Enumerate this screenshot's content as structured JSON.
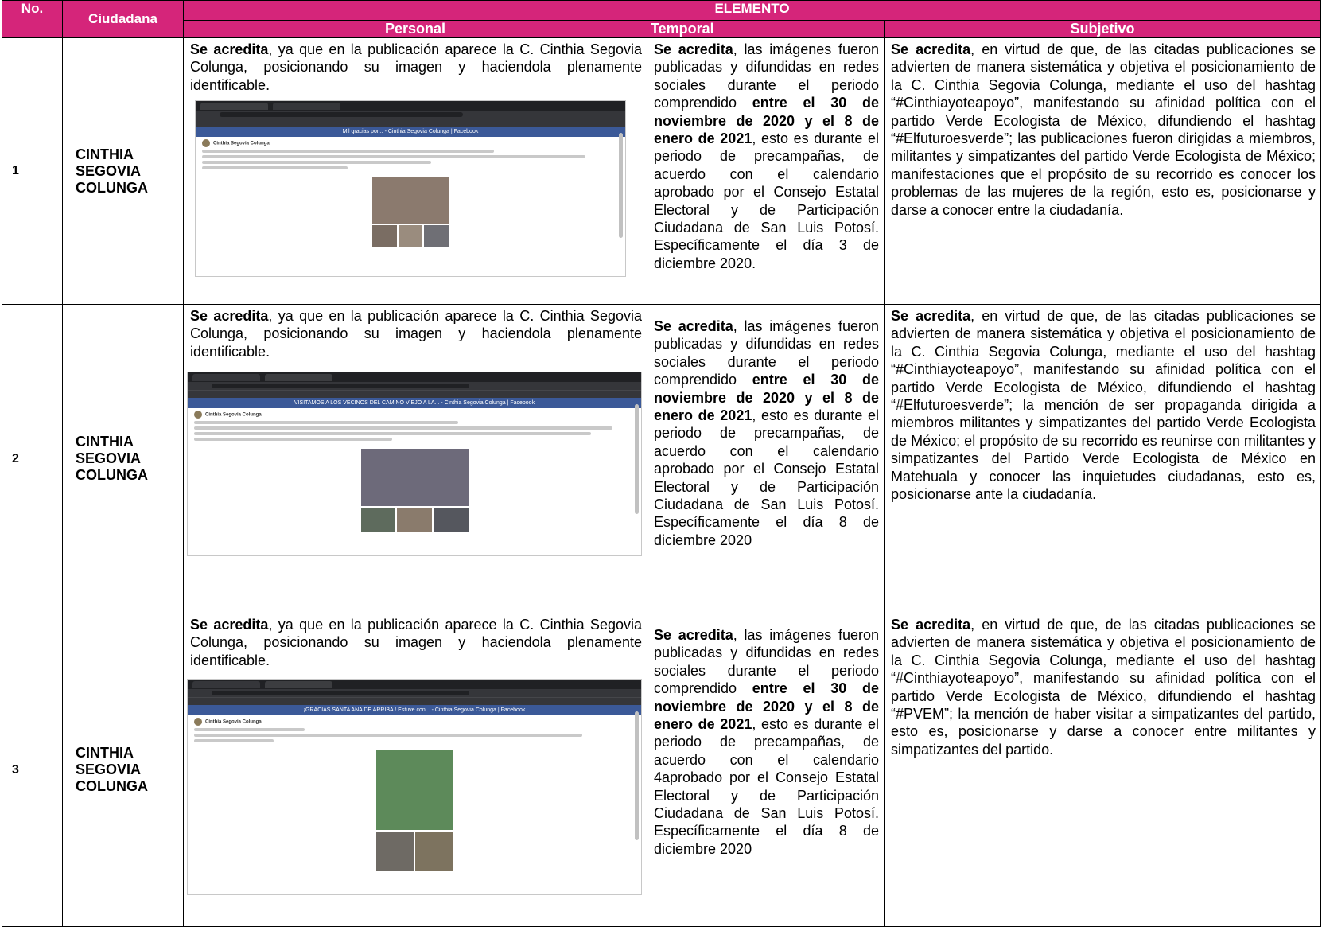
{
  "header": {
    "no": "No.",
    "ciudadana": "Ciudadana",
    "elemento": "ELEMENTO",
    "personal": "Personal",
    "temporal": "Temporal",
    "subjetivo": "Subjetivo"
  },
  "colors": {
    "header_bg": "#d5257a",
    "header_text": "#ffffff"
  },
  "rows": [
    {
      "no": "1",
      "name": "CINTHIA SEGOVIA COLUNGA",
      "personal": {
        "bold": "Se acredita",
        "text": ", ya que en la publicación aparece la C. Cinthia Segovia Colunga, posicionando su imagen y haciendola plenamente identificable."
      },
      "screenshot": {
        "icon": "facebook-post-screenshot",
        "page_title": "Mil gracias por... - Cinthia Segovia Colunga | Facebook"
      },
      "temporal": {
        "b1": "Se acredita",
        "t1": ", las imágenes fueron publicadas y difundidas en redes sociales durante el periodo comprendido ",
        "b2": "entre el 30 de noviembre de 2020 y el 8 de enero de 2021",
        "t2": ", esto es durante el periodo de precampañas, de acuerdo con el calendario aprobado por el Consejo Estatal Electoral y de Participación Ciudadana de San Luis Potosí. Específicamente el día 3 de diciembre 2020."
      },
      "subjetivo": {
        "bold": "Se acredita",
        "text": ", en virtud de que, de las citadas publicaciones se advierten de manera sistemática y objetiva el posicionamiento de la C. Cinthia Segovia Colunga, mediante el uso del hashtag “#Cinthiayoteapoyo”, manifestando su afinidad política con el partido Verde Ecologista de México, difundiendo el hashtag “#Elfuturoesverde”; las publicaciones fueron dirigidas a miembros, militantes y simpatizantes del partido Verde Ecologista de México; manifestaciones que el propósito de su recorrido es conocer los problemas de las mujeres de la región, esto es, posicionarse y darse a conocer entre la ciudadanía."
      }
    },
    {
      "no": "2",
      "name": "CINTHIA SEGOVIA COLUNGA",
      "personal": {
        "bold": "Se acredita",
        "text": ", ya que en la publicación aparece la C. Cinthia Segovia Colunga, posicionando su imagen y haciendola plenamente identificable."
      },
      "screenshot": {
        "icon": "facebook-post-screenshot",
        "page_title": "VISITAMOS A LOS VECINOS DEL CAMINO VIEJO A LA... - Cinthia Segovia Colunga | Facebook"
      },
      "temporal": {
        "b1": "Se acredita",
        "t1": ", las imágenes fueron publicadas y difundidas en redes sociales durante el periodo comprendido ",
        "b2": "entre el 30 de noviembre de 2020 y el 8 de enero de 2021",
        "t2": ", esto es durante el periodo de precampañas, de acuerdo con el calendario aprobado por el Consejo Estatal Electoral y de Participación Ciudadana de San Luis Potosí. Específicamente el día 8 de diciembre 2020"
      },
      "subjetivo": {
        "bold": "Se acredita",
        "text": ", en virtud de que, de las citadas publicaciones se advierten de manera sistemática y objetiva el posicionamiento de la C. Cinthia Segovia Colunga, mediante el uso del hashtag “#Cinthiayoteapoyo”, manifestando su afinidad política con el partido Verde Ecologista de México, difundiendo el hashtag “#Elfuturoesverde”; la mención de ser propaganda dirigida a miembros militantes y simpatizantes del partido Verde Ecologista de México; el propósito de su recorrido es reunirse con militantes y simpatizantes del Partido Verde Ecologista de México en Matehuala y conocer las inquietudes ciudadanas, esto es, posicionarse ante la ciudadanía."
      }
    },
    {
      "no": "3",
      "name": "CINTHIA SEGOVIA COLUNGA",
      "personal": {
        "bold": "Se acredita",
        "text": ", ya que en la publicación aparece la C. Cinthia Segovia Colunga, posicionando su imagen y haciendola plenamente identificable."
      },
      "screenshot": {
        "icon": "facebook-post-screenshot",
        "page_title": "¡GRACIAS SANTA ANA DE ARRIBA ! Estuve con... - Cinthia Segovia Colunga | Facebook"
      },
      "temporal": {
        "b1": "Se acredita",
        "t1": ", las imágenes fueron publicadas y difundidas en redes sociales durante el periodo comprendido ",
        "b2": "entre el 30 de noviembre de 2020 y el 8 de enero de 2021",
        "t2": ", esto es durante el periodo de precampañas, de acuerdo con el calendario 4aprobado por el Consejo Estatal Electoral y de Participación Ciudadana de San Luis Potosí. Específicamente el día 8 de diciembre 2020"
      },
      "subjetivo": {
        "bold": "Se acredita",
        "text": ", en virtud de que, de las citadas publicaciones se advierten de manera sistemática y objetiva el posicionamiento de la C. Cinthia Segovia Colunga, mediante el uso del hashtag “#Cinthiayoteapoyo”, manifestando su afinidad política con el partido Verde Ecologista de México, difundiendo el hashtag “#PVEM”; la mención de haber visitar a simpatizantes del partido, esto es, posicionarse y darse a conocer entre militantes y simpatizantes del partido."
      }
    }
  ]
}
